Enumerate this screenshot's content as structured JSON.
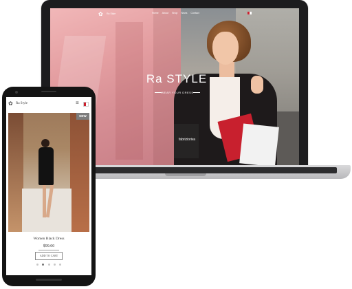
{
  "laptop": {
    "site": {
      "logo_text": "Ra Style",
      "nav_links": [
        "Home",
        "About",
        "Shop",
        "News",
        "Contact"
      ],
      "hero_title": "Ra STYLE",
      "hero_cta": "WEAR YOUR DRESS",
      "bag_brand": "fabrizioriva"
    }
  },
  "phone": {
    "header": {
      "logo_text": "Ra Style"
    },
    "product": {
      "badge": "NEW",
      "title": "Women Black Dress",
      "price": "$99.00",
      "add_to_cart_label": "ADD TO CART"
    },
    "carousel": {
      "dot_count": 5,
      "active_index": 1
    }
  },
  "colors": {
    "laptop_frame": "#1c1c1e",
    "hero_pink": "#e49ea1",
    "badge_gray": "#7c7c7c"
  },
  "icons": [
    "logo-icon",
    "menu-icon",
    "flag-icon",
    "camera-icon"
  ]
}
